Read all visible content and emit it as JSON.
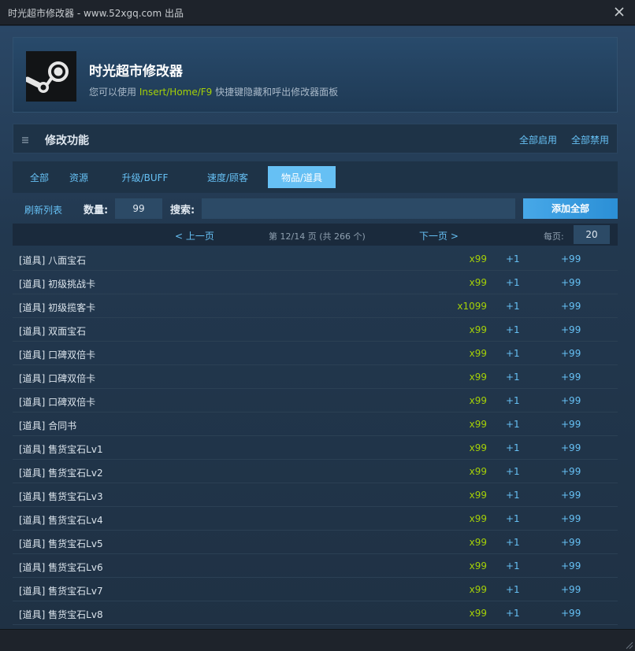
{
  "window": {
    "title": "时光超市修改器 - www.52xgq.com 出品"
  },
  "header": {
    "app_name": "时光超市修改器",
    "desc_prefix": "您可以使用 ",
    "desc_hotkeys": "Insert/Home/F9",
    "desc_suffix": " 快捷键隐藏和呼出修改器面板"
  },
  "section": {
    "label": "修改功能",
    "enable_all": "全部启用",
    "disable_all": "全部禁用"
  },
  "tabs": [
    {
      "label": "全部"
    },
    {
      "label": "资源"
    },
    {
      "label": "升级/BUFF"
    },
    {
      "label": "速度/顾客"
    },
    {
      "label": "物品/道具"
    }
  ],
  "active_tab": "物品/道具",
  "toolbar": {
    "refresh": "刷新列表",
    "qty_label": "数量:",
    "qty_value": "99",
    "search_label": "搜索:",
    "search_value": "",
    "add_all": "添加全部"
  },
  "pager": {
    "prev": "< 上一页",
    "info": "第 12/14 页 (共 266 个)",
    "next": "下一页 >",
    "per_page_label": "每页:",
    "per_page_value": "20"
  },
  "items": [
    {
      "name": "[道具] 八面宝石",
      "amount": "x99",
      "plus1": "+1",
      "plus99": "+99"
    },
    {
      "name": "[道具] 初级挑战卡",
      "amount": "x99",
      "plus1": "+1",
      "plus99": "+99"
    },
    {
      "name": "[道具] 初级揽客卡",
      "amount": "x1099",
      "plus1": "+1",
      "plus99": "+99"
    },
    {
      "name": "[道具] 双面宝石",
      "amount": "x99",
      "plus1": "+1",
      "plus99": "+99"
    },
    {
      "name": "[道具] 口碑双倍卡",
      "amount": "x99",
      "plus1": "+1",
      "plus99": "+99"
    },
    {
      "name": "[道具] 口碑双倍卡",
      "amount": "x99",
      "plus1": "+1",
      "plus99": "+99"
    },
    {
      "name": "[道具] 口碑双倍卡",
      "amount": "x99",
      "plus1": "+1",
      "plus99": "+99"
    },
    {
      "name": "[道具] 合同书",
      "amount": "x99",
      "plus1": "+1",
      "plus99": "+99"
    },
    {
      "name": "[道具] 售货宝石Lv1",
      "amount": "x99",
      "plus1": "+1",
      "plus99": "+99"
    },
    {
      "name": "[道具] 售货宝石Lv2",
      "amount": "x99",
      "plus1": "+1",
      "plus99": "+99"
    },
    {
      "name": "[道具] 售货宝石Lv3",
      "amount": "x99",
      "plus1": "+1",
      "plus99": "+99"
    },
    {
      "name": "[道具] 售货宝石Lv4",
      "amount": "x99",
      "plus1": "+1",
      "plus99": "+99"
    },
    {
      "name": "[道具] 售货宝石Lv5",
      "amount": "x99",
      "plus1": "+1",
      "plus99": "+99"
    },
    {
      "name": "[道具] 售货宝石Lv6",
      "amount": "x99",
      "plus1": "+1",
      "plus99": "+99"
    },
    {
      "name": "[道具] 售货宝石Lv7",
      "amount": "x99",
      "plus1": "+1",
      "plus99": "+99"
    },
    {
      "name": "[道具] 售货宝石Lv8",
      "amount": "x99",
      "plus1": "+1",
      "plus99": "+99"
    }
  ],
  "icons": {
    "close": "close-icon",
    "logo": "steam-logo-icon",
    "menu": "menu-icon",
    "resize": "resize-grip-icon"
  },
  "colors": {
    "accent": "#66c0f4",
    "amount": "#a4d007",
    "background": "#1b2838"
  }
}
